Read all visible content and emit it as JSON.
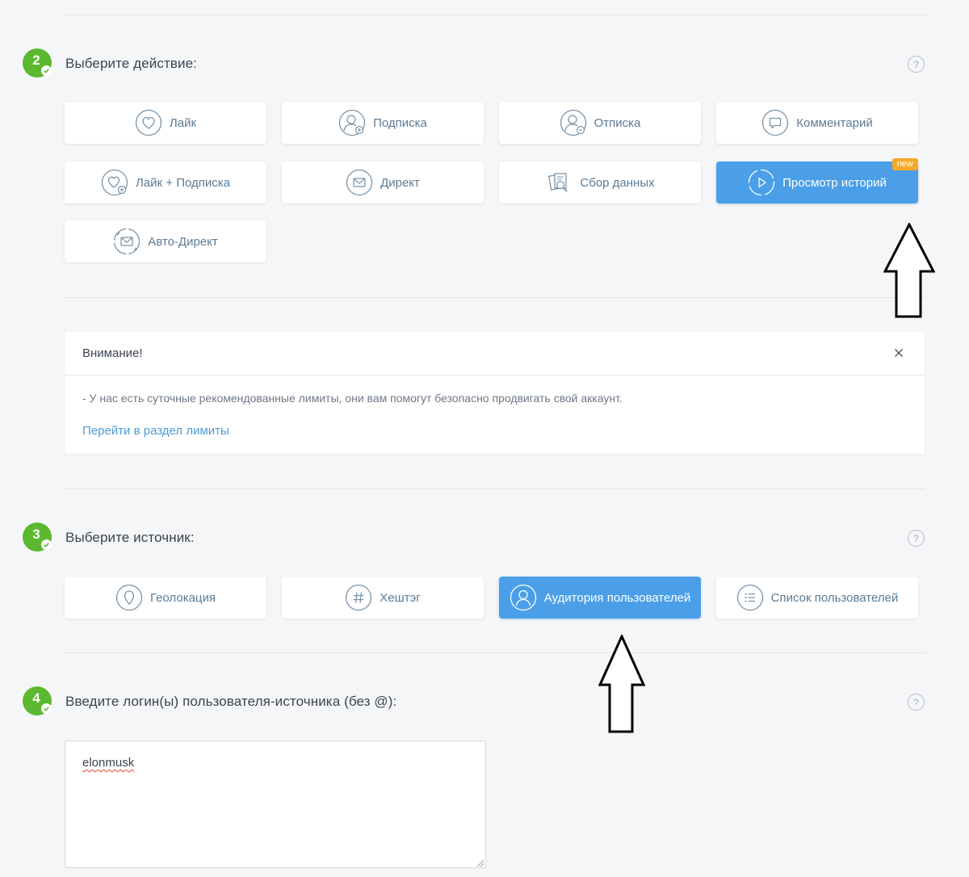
{
  "step2": {
    "number": "2",
    "title": "Выберите действие:",
    "help": "?",
    "actions": [
      {
        "label": "Лайк"
      },
      {
        "label": "Подписка"
      },
      {
        "label": "Отписка"
      },
      {
        "label": "Комментарий"
      },
      {
        "label": "Лайк + Подписка"
      },
      {
        "label": "Директ"
      },
      {
        "label": "Сбор данных"
      },
      {
        "label": "Просмотр историй",
        "badge": "new",
        "selected": true
      },
      {
        "label": "Авто-Директ"
      }
    ]
  },
  "alert": {
    "title": "Внимание!",
    "text": "- У нас есть суточные рекомендованные лимиты, они вам помогут безопасно продвигать свой аккаунт.",
    "link": "Перейти в раздел лимиты"
  },
  "step3": {
    "number": "3",
    "title": "Выберите источник:",
    "help": "?",
    "sources": [
      {
        "label": "Геолокация"
      },
      {
        "label": "Хештэг"
      },
      {
        "label": "Аудитория пользователей",
        "selected": true
      },
      {
        "label": "Список пользователей"
      }
    ]
  },
  "step4": {
    "number": "4",
    "title": "Введите логин(ы) пользователя-источника (без @):",
    "help": "?",
    "input_value": "elonmusk"
  },
  "colors": {
    "accent": "#4a9fe8",
    "step_badge": "#5cb82e",
    "new_badge": "#f4a926",
    "link": "#4a9bd6"
  }
}
